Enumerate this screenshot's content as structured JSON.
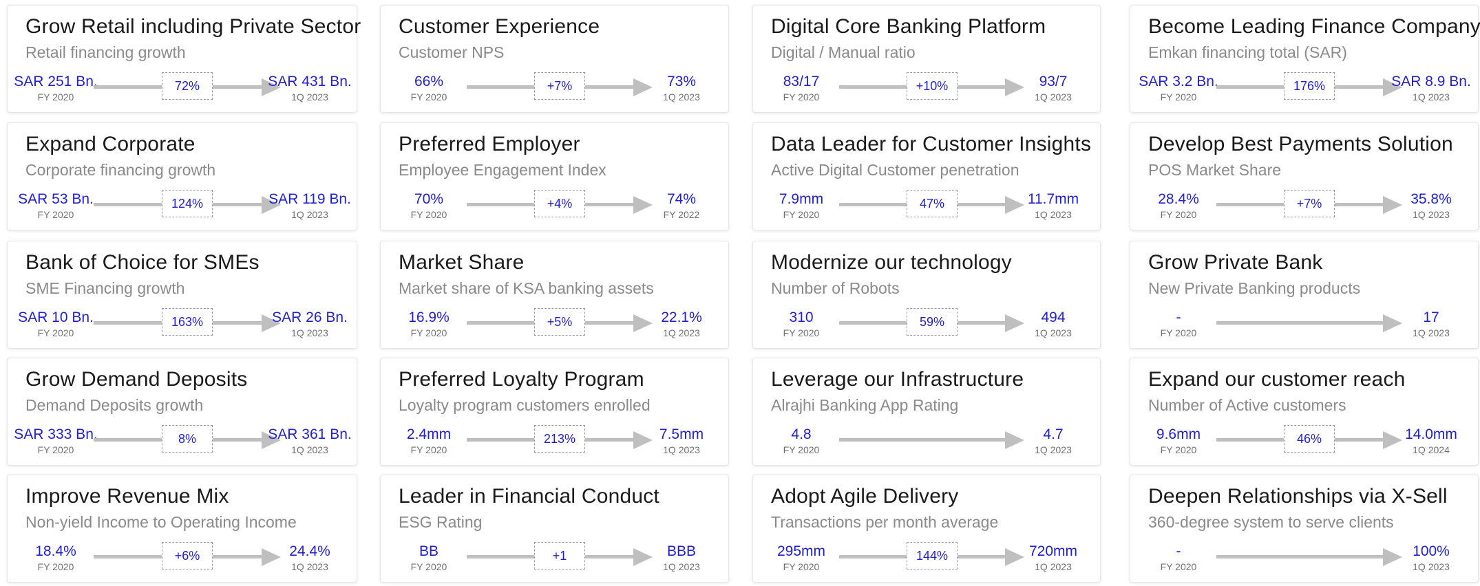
{
  "colors": {
    "value": "#1f1fd6",
    "title": "#1a1a1a",
    "subtitle": "#8a8a8a",
    "arrow": "#bfbfbf"
  },
  "columns": [
    [
      {
        "title": "Grow Retail including Private Sector",
        "subtitle": "Retail financing growth",
        "from_value": "SAR 251 Bn.",
        "from_date": "FY 2020",
        "change": "72%",
        "to_value": "SAR 431 Bn.",
        "to_date": "1Q 2023"
      },
      {
        "title": "Expand Corporate",
        "subtitle": "Corporate financing growth",
        "from_value": "SAR 53 Bn.",
        "from_date": "FY 2020",
        "change": "124%",
        "to_value": "SAR 119 Bn.",
        "to_date": "1Q 2023"
      },
      {
        "title": "Bank of Choice for SMEs",
        "subtitle": "SME Financing growth",
        "from_value": "SAR 10 Bn.",
        "from_date": "FY 2020",
        "change": "163%",
        "to_value": "SAR 26 Bn.",
        "to_date": "1Q 2023"
      },
      {
        "title": "Grow Demand Deposits",
        "subtitle": "Demand Deposits growth",
        "from_value": "SAR 333 Bn.",
        "from_date": "FY 2020",
        "change": "8%",
        "to_value": "SAR 361 Bn.",
        "to_date": "1Q 2023"
      },
      {
        "title": "Improve Revenue Mix",
        "subtitle": "Non-yield Income to Operating Income",
        "from_value": "18.4%",
        "from_date": "FY 2020",
        "change": "+6%",
        "to_value": "24.4%",
        "to_date": "1Q 2023"
      }
    ],
    [
      {
        "title": "Customer Experience",
        "subtitle": "Customer NPS",
        "from_value": "66%",
        "from_date": "FY 2020",
        "change": "+7%",
        "to_value": "73%",
        "to_date": "1Q 2023"
      },
      {
        "title": "Preferred Employer",
        "subtitle": "Employee Engagement Index",
        "from_value": "70%",
        "from_date": "FY 2020",
        "change": "+4%",
        "to_value": "74%",
        "to_date": "FY 2022"
      },
      {
        "title": "Market Share",
        "subtitle": "Market share of KSA banking assets",
        "from_value": "16.9%",
        "from_date": "FY 2020",
        "change": "+5%",
        "to_value": "22.1%",
        "to_date": "1Q 2023"
      },
      {
        "title": "Preferred Loyalty Program",
        "subtitle": "Loyalty program customers enrolled",
        "from_value": "2.4mm",
        "from_date": "FY 2020",
        "change": "213%",
        "to_value": "7.5mm",
        "to_date": "1Q 2023"
      },
      {
        "title": "Leader in Financial Conduct",
        "subtitle": "ESG Rating",
        "from_value": "BB",
        "from_date": "FY 2020",
        "change": "+1",
        "to_value": "BBB",
        "to_date": "1Q 2023"
      }
    ],
    [
      {
        "title": "Digital Core Banking Platform",
        "subtitle": "Digital / Manual ratio",
        "from_value": "83/17",
        "from_date": "FY 2020",
        "change": "+10%",
        "to_value": "93/7",
        "to_date": "1Q 2023"
      },
      {
        "title": "Data Leader for Customer Insights",
        "subtitle": "Active Digital Customer penetration",
        "from_value": "7.9mm",
        "from_date": "FY 2020",
        "change": "47%",
        "to_value": "11.7mm",
        "to_date": "1Q 2023"
      },
      {
        "title": "Modernize our technology",
        "subtitle": "Number of Robots",
        "from_value": "310",
        "from_date": "FY 2020",
        "change": "59%",
        "to_value": "494",
        "to_date": "1Q 2023"
      },
      {
        "title": "Leverage our Infrastructure",
        "subtitle": "Alrajhi Banking App Rating",
        "from_value": "4.8",
        "from_date": "FY 2020",
        "change": "",
        "to_value": "4.7",
        "to_date": "1Q 2023"
      },
      {
        "title": "Adopt Agile Delivery",
        "subtitle": "Transactions per month average",
        "from_value": "295mm",
        "from_date": "FY 2020",
        "change": "144%",
        "to_value": "720mm",
        "to_date": "1Q 2023"
      }
    ],
    [
      {
        "title": "Become Leading Finance Company",
        "subtitle": "Emkan financing total (SAR)",
        "from_value": "SAR 3.2 Bn.",
        "from_date": "FY 2020",
        "change": "176%",
        "to_value": "SAR 8.9 Bn.",
        "to_date": "1Q 2023"
      },
      {
        "title": "Develop Best Payments Solution",
        "subtitle": "POS Market Share",
        "from_value": "28.4%",
        "from_date": "FY 2020",
        "change": "+7%",
        "to_value": "35.8%",
        "to_date": "1Q 2023"
      },
      {
        "title": "Grow Private Bank",
        "subtitle": "New Private Banking products",
        "from_value": "-",
        "from_date": "FY 2020",
        "change": "",
        "to_value": "17",
        "to_date": "1Q 2023"
      },
      {
        "title": "Expand our customer reach",
        "subtitle": "Number of Active customers",
        "from_value": "9.6mm",
        "from_date": "FY 2020",
        "change": "46%",
        "to_value": "14.0mm",
        "to_date": "1Q 2024"
      },
      {
        "title": "Deepen Relationships via X-Sell",
        "subtitle": "360-degree system to serve clients",
        "from_value": "-",
        "from_date": "FY 2020",
        "change": "",
        "to_value": "100%",
        "to_date": "1Q 2023"
      }
    ]
  ]
}
